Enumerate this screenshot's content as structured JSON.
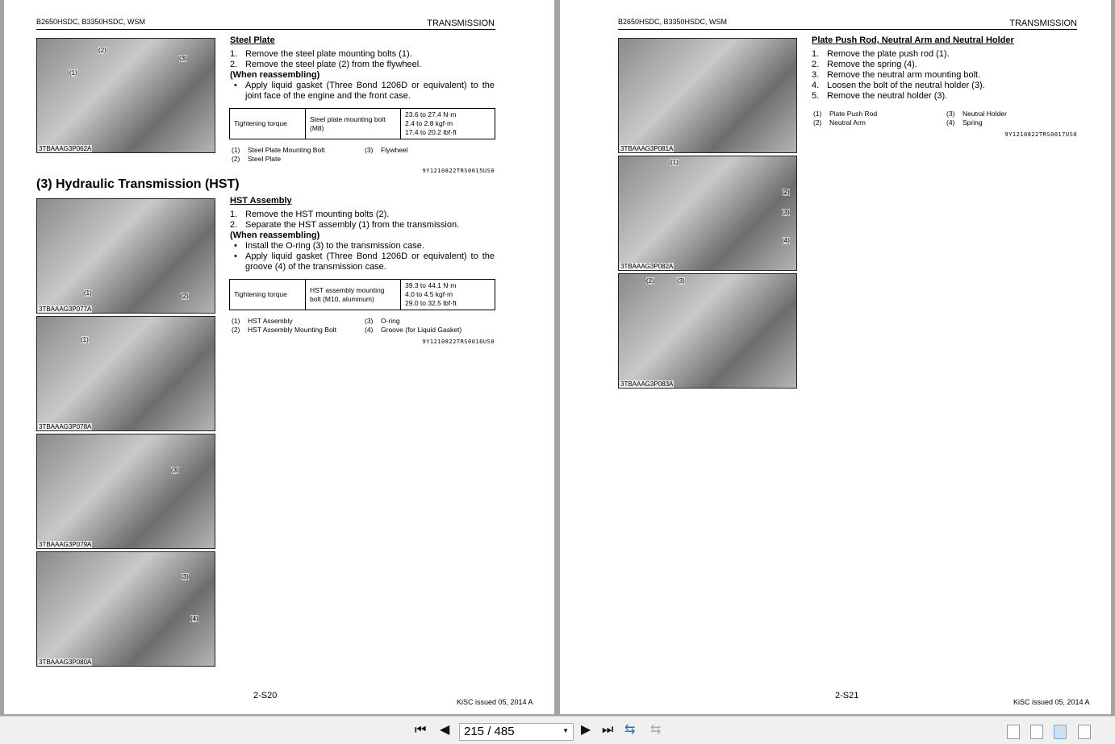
{
  "left_page": {
    "header_left": "B2650HSDC, B3350HSDC, WSM",
    "header_right": "TRANSMISSION",
    "steel_plate": {
      "title": "Steel Plate",
      "steps": [
        "Remove the steel plate mounting bolts (1).",
        "Remove the steel plate (2) from the flywheel."
      ],
      "reassembling": "(When reassembling)",
      "bullets": [
        "Apply liquid gasket (Three Bond 1206D or equivalent) to the joint face of the engine and the front case."
      ],
      "torque": {
        "label": "Tightening torque",
        "item": "Steel plate mounting bolt (M8)",
        "values": [
          "23.6 to 27.4 N·m",
          "2.4 to 2.8 kgf·m",
          "17.4 to 20.2 lbf·ft"
        ]
      },
      "legend": [
        [
          "(1)",
          "Steel Plate Mounting Bolt"
        ],
        [
          "(3)",
          "Flywheel"
        ],
        [
          "(2)",
          "Steel Plate"
        ]
      ],
      "code": "9Y1210822TRS0015US0"
    },
    "section_title": "(3)  Hydraulic Transmission (HST)",
    "hst": {
      "title": "HST Assembly",
      "steps": [
        "Remove the HST mounting bolts (2).",
        "Separate the HST assembly (1) from the transmission."
      ],
      "reassembling": "(When reassembling)",
      "bullets": [
        "Install the O-ring (3) to the transmission case.",
        "Apply liquid gasket (Three Bond 1206D or equivalent) to the groove (4) of the transmission case."
      ],
      "torque": {
        "label": "Tightening torque",
        "item": "HST assembly mounting bolt (M10, aluminum)",
        "values": [
          "39.3 to 44.1 N·m",
          "4.0 to 4.5 kgf·m",
          "29.0 to 32.5 lbf·ft"
        ]
      },
      "legend": [
        [
          "(1)",
          "HST Assembly"
        ],
        [
          "(3)",
          "O-ring"
        ],
        [
          "(2)",
          "HST Assembly Mounting Bolt"
        ],
        [
          "(4)",
          "Groove (for Liquid Gasket)"
        ]
      ],
      "code": "9Y1210822TRS0016US0"
    },
    "images": [
      {
        "caption": "3TBAAAG3P062A",
        "callouts": [
          "(1)",
          "(2)",
          "(3)"
        ]
      },
      {
        "caption": "3TBAAAG3P077A",
        "callouts": [
          "(1)",
          "(2)"
        ]
      },
      {
        "caption": "3TBAAAG3P078A",
        "callouts": [
          "(1)"
        ]
      },
      {
        "caption": "3TBAAAG3P079A",
        "callouts": [
          "(3)"
        ]
      },
      {
        "caption": "3TBAAAG3P080A",
        "callouts": [
          "(3)",
          "(4)"
        ]
      }
    ],
    "page_number": "2-S20",
    "issued": "KiSC issued 05, 2014 A"
  },
  "right_page": {
    "header_left": "B2650HSDC, B3350HSDC, WSM",
    "header_right": "TRANSMISSION",
    "section": {
      "title": "Plate Push Rod, Neutral Arm and Neutral Holder",
      "steps": [
        "Remove the plate push rod (1).",
        "Remove the spring (4).",
        "Remove the neutral arm mounting bolt.",
        "Loosen the bolt of the neutral holder (3).",
        "Remove the neutral holder (3)."
      ],
      "legend": [
        [
          "(1)",
          "Plate Push Rod"
        ],
        [
          "(3)",
          "Neutral Holder"
        ],
        [
          "(2)",
          "Neutral Arm"
        ],
        [
          "(4)",
          "Spring"
        ]
      ],
      "code": "9Y1210822TRS0017US0"
    },
    "images": [
      {
        "caption": "3TBAAAG3P081A",
        "callouts": []
      },
      {
        "caption": "3TBAAAG3P082A",
        "callouts": [
          "(1)",
          "(2)",
          "(3)",
          "(4)"
        ]
      },
      {
        "caption": "3TBAAAG3P083A",
        "callouts": [
          "(2)",
          "(3)"
        ]
      }
    ],
    "page_number": "2-S21",
    "issued": "KiSC issued 05, 2014 A"
  },
  "toolbar": {
    "page_field": "215 / 485"
  }
}
